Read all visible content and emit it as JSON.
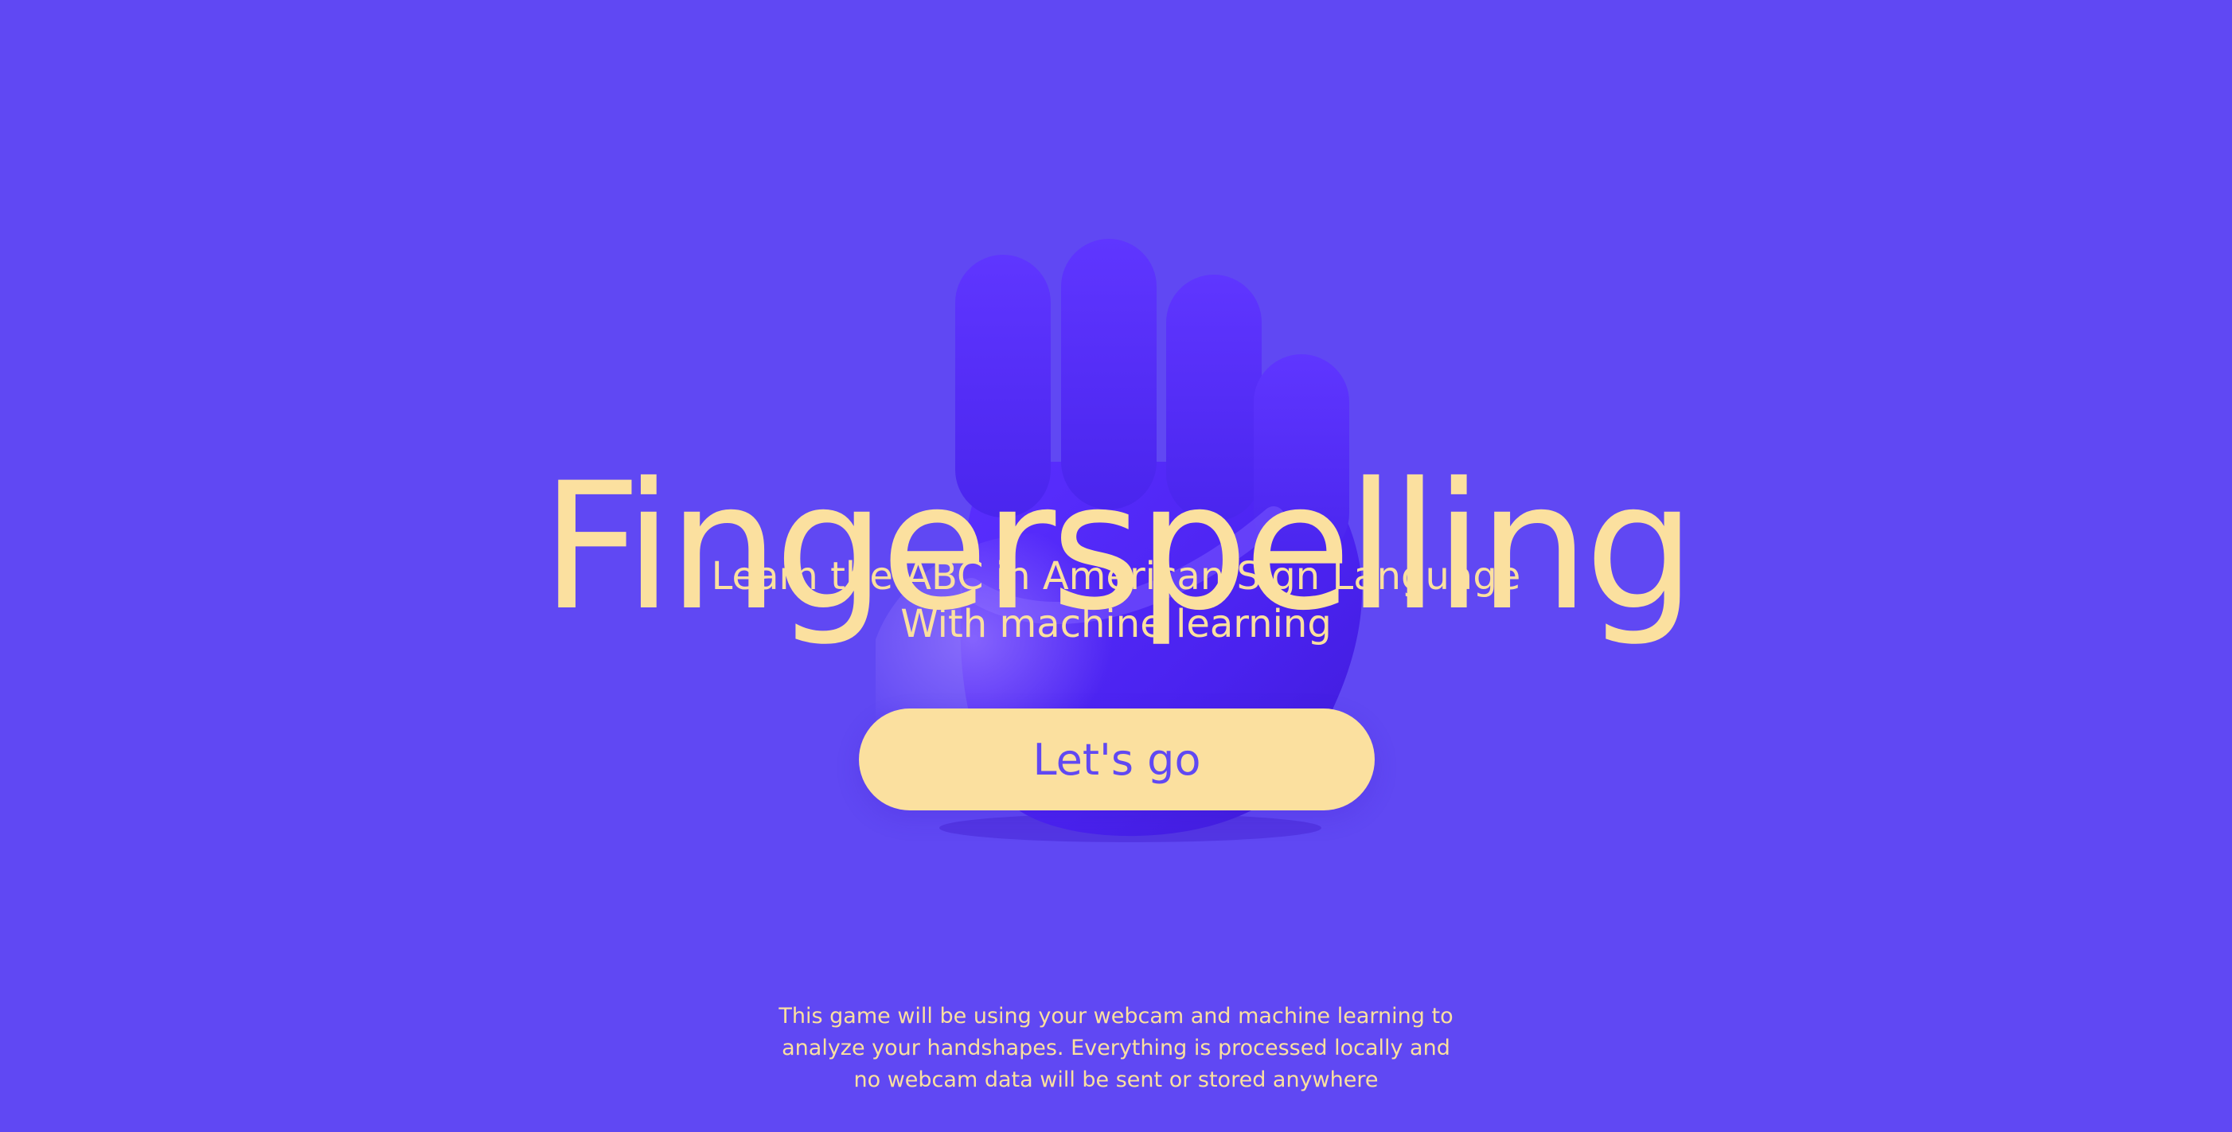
{
  "colors": {
    "background": "#6048f3",
    "accent": "#fbe09f",
    "hand_dark": "#4b27ee",
    "hand_mid": "#5b30ff",
    "hand_light": "#8b70ff"
  },
  "hero": {
    "illustration": "fist-hand-icon",
    "title": "Fingerspelling",
    "subtitle_line_1": "Learn the ABC in American Sign Language",
    "subtitle_line_2": "With machine learning",
    "cta_label": "Let's go"
  },
  "footer": {
    "line_1": "This game will be using your webcam and machine learning to",
    "line_2": "analyze your handshapes. Everything is processed locally and",
    "line_3": "no webcam data will be sent or stored anywhere"
  }
}
